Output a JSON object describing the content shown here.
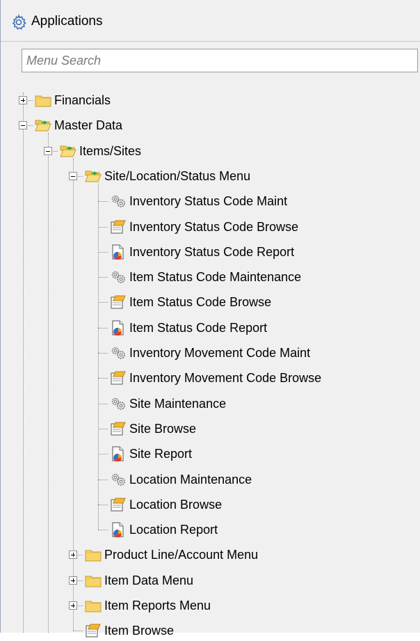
{
  "header": {
    "title": "Applications",
    "icon": "gear-icon"
  },
  "search": {
    "placeholder": "Menu Search",
    "value": ""
  },
  "tree": {
    "nodes": [
      {
        "label": "Financials",
        "level": 0,
        "icon": "folder-closed-icon",
        "expander": "plus"
      },
      {
        "label": "Master Data",
        "level": 0,
        "icon": "folder-open-icon",
        "expander": "minus"
      },
      {
        "label": "Items/Sites",
        "level": 1,
        "icon": "folder-open-icon",
        "expander": "minus"
      },
      {
        "label": "Site/Location/Status Menu",
        "level": 2,
        "icon": "folder-open-icon",
        "expander": "minus"
      },
      {
        "label": "Inventory Status Code Maint",
        "level": 3,
        "icon": "gears-icon"
      },
      {
        "label": "Inventory Status Code Browse",
        "level": 3,
        "icon": "browse-icon"
      },
      {
        "label": "Inventory Status Code Report",
        "level": 3,
        "icon": "report-icon"
      },
      {
        "label": "Item Status Code Maintenance",
        "level": 3,
        "icon": "gears-icon"
      },
      {
        "label": "Item Status Code Browse",
        "level": 3,
        "icon": "browse-icon"
      },
      {
        "label": "Item Status Code Report",
        "level": 3,
        "icon": "report-icon"
      },
      {
        "label": "Inventory Movement Code Maint",
        "level": 3,
        "icon": "gears-icon"
      },
      {
        "label": "Inventory Movement Code Browse",
        "level": 3,
        "icon": "browse-icon"
      },
      {
        "label": "Site Maintenance",
        "level": 3,
        "icon": "gears-icon"
      },
      {
        "label": "Site Browse",
        "level": 3,
        "icon": "browse-icon"
      },
      {
        "label": "Site Report",
        "level": 3,
        "icon": "report-icon"
      },
      {
        "label": "Location Maintenance",
        "level": 3,
        "icon": "gears-icon"
      },
      {
        "label": "Location Browse",
        "level": 3,
        "icon": "browse-icon"
      },
      {
        "label": "Location Report",
        "level": 3,
        "icon": "report-icon"
      },
      {
        "label": "Product Line/Account Menu",
        "level": 2,
        "icon": "folder-closed-icon",
        "expander": "plus"
      },
      {
        "label": "Item Data Menu",
        "level": 2,
        "icon": "folder-closed-icon",
        "expander": "plus"
      },
      {
        "label": "Item Reports Menu",
        "level": 2,
        "icon": "folder-closed-icon",
        "expander": "plus"
      },
      {
        "label": "Item Browse",
        "level": 2,
        "icon": "browse-icon"
      }
    ]
  }
}
